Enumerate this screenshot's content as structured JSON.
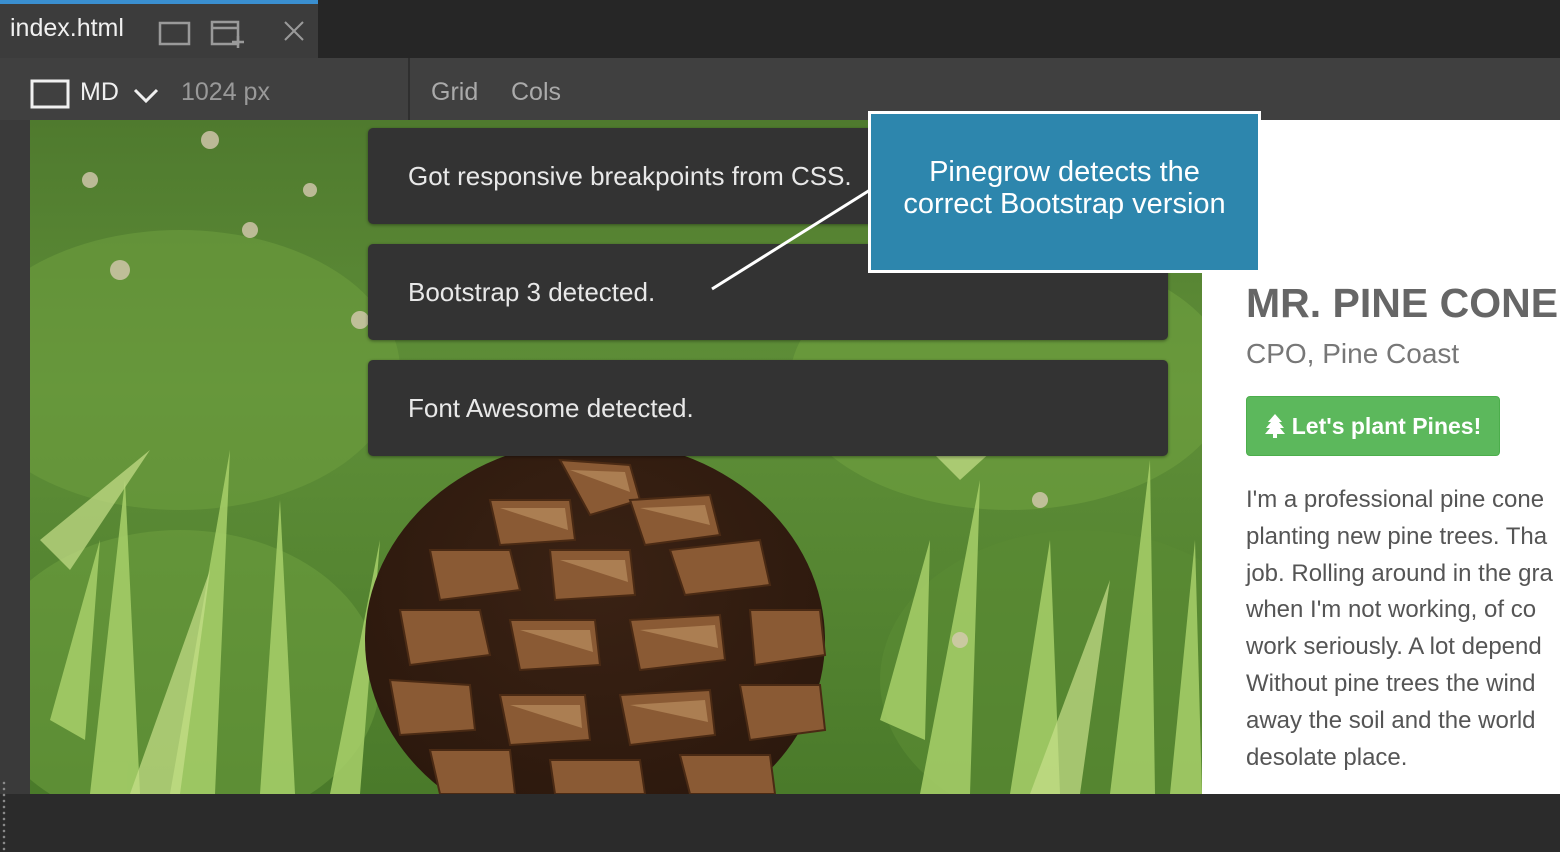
{
  "tab": {
    "title": "index.html",
    "icons": [
      "window-icon",
      "new-window-icon",
      "close-icon"
    ]
  },
  "toolbar": {
    "device_icon": "device-frame-icon",
    "breakpoint": "MD",
    "chevron_icon": "chevron-down-icon",
    "width_label": "1024 px",
    "grid_label": "Grid",
    "cols_label": "Cols"
  },
  "notifications": [
    "Got responsive breakpoints from CSS.",
    "Bootstrap 3 detected.",
    "Font Awesome detected."
  ],
  "callout": {
    "line1": "Pinegrow detects the",
    "line2": "correct Bootstrap version"
  },
  "page": {
    "name": "MR. PINE CONE",
    "role": "CPO, Pine Coast",
    "button_icon": "tree-icon",
    "button_label": "Let's plant Pines!",
    "bio_lines": [
      "I'm a professional pine cone",
      "planting new pine trees. Tha",
      "job. Rolling around in the gra",
      "when I'm not working, of co",
      "work seriously. A lot depend",
      "Without pine trees the wind",
      "away the soil and the world",
      "desolate place."
    ]
  },
  "colors": {
    "accent": "#3a8fd0",
    "button": "#5cb85c",
    "callout": "#2d86ad",
    "notification": "#333333"
  }
}
